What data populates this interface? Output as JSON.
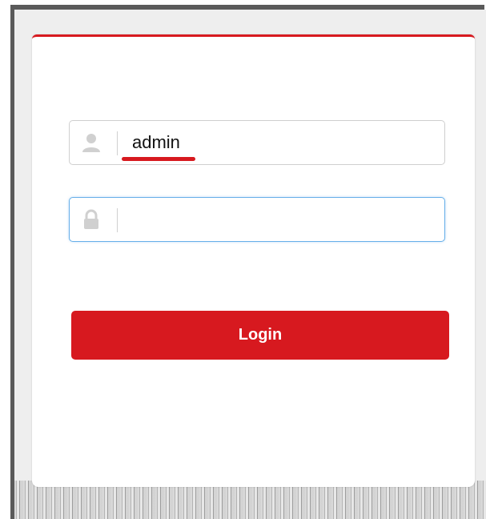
{
  "login_form": {
    "username": {
      "value": "admin",
      "icon": "user-icon"
    },
    "password": {
      "value": "",
      "icon": "lock-icon"
    },
    "login_label": "Login"
  },
  "colors": {
    "accent": "#d7191f",
    "focus_border": "#66afe9"
  }
}
